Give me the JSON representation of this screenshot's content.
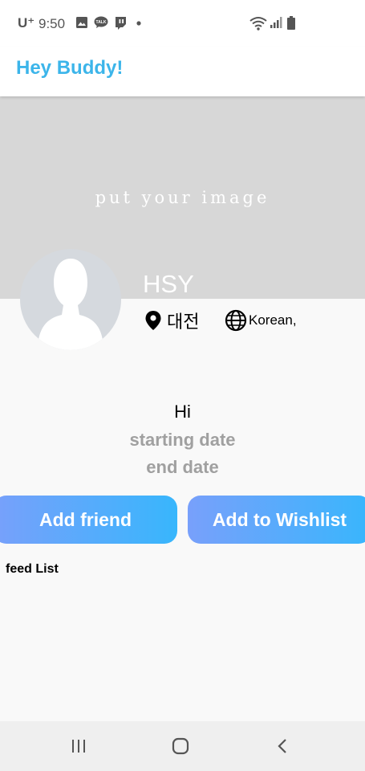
{
  "status_bar": {
    "carrier": "U⁺",
    "time": "9:50",
    "left_icons": [
      "image-icon",
      "kakaotalk-icon",
      "twitch-icon",
      "dot-icon"
    ],
    "right_icons": [
      "wifi-icon",
      "signal-icon",
      "battery-icon"
    ],
    "talk_badge": "TALK"
  },
  "app_bar": {
    "title": "Hey Buddy!"
  },
  "profile": {
    "cover_placeholder": "put your image",
    "name": "HSY",
    "location": "대전",
    "languages": "Korean,",
    "greeting": "Hi",
    "starting_date": "starting date",
    "end_date": "end date"
  },
  "actions": {
    "add_friend": "Add friend",
    "add_wishlist": "Add to Wishlist"
  },
  "feed": {
    "title": "feed List"
  },
  "colors": {
    "accent": "#3cb5ea",
    "button_gradient_start": "#78a0fb",
    "button_gradient_end": "#38b6fc",
    "cover": "#d7d7d7",
    "muted_text": "#a0a0a0"
  }
}
